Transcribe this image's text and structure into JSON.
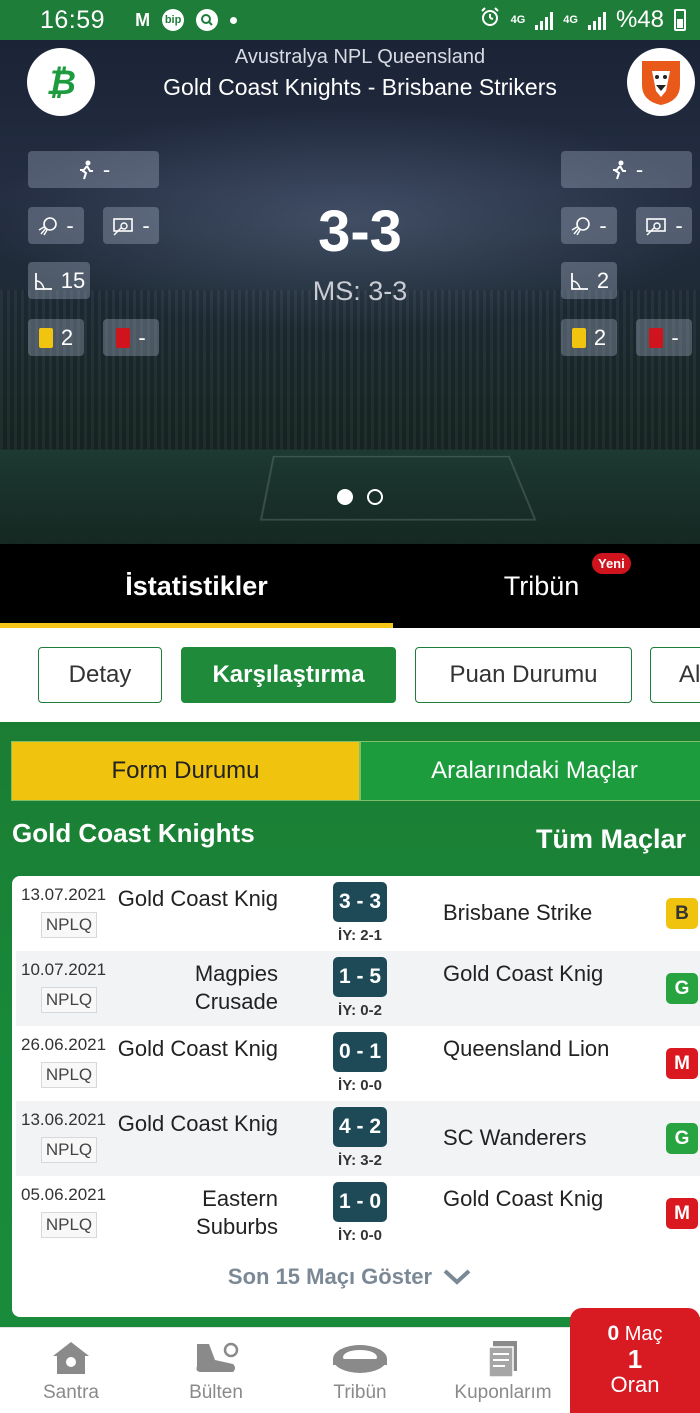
{
  "status_bar": {
    "time": "16:59",
    "m_icon": "M",
    "bip_icon": "bip",
    "network_1": "4G",
    "network_2": "4G",
    "battery": "%48"
  },
  "header": {
    "league": "Avustralya NPL Queensland",
    "match_title": "Gold Coast Knights - Brisbane Strikers",
    "score": "3-3",
    "full_time": "MS: 3-3",
    "home_stats": {
      "subs": "-",
      "shots_on": "-",
      "shots_off": "-",
      "corners": "15",
      "yellow": "2",
      "red": "-"
    },
    "away_stats": {
      "subs": "-",
      "shots_on": "-",
      "shots_off": "-",
      "corners": "2",
      "yellow": "2",
      "red": "-"
    },
    "colors": {
      "home_logo": "#1f9b3f",
      "away_logo": "#e8591a"
    }
  },
  "tabs": {
    "stats": "İstatistikler",
    "stand": "Tribün",
    "new_badge": "Yeni"
  },
  "chips": [
    "Detay",
    "Karşılaştırma",
    "Puan Durumu",
    "Al"
  ],
  "segments": {
    "form": "Form Durumu",
    "h2h": "Aralarındaki Maçlar"
  },
  "panel": {
    "team": "Gold Coast Knights",
    "all_matches": "Tüm Maçlar"
  },
  "matches": [
    {
      "date": "13.07.2021",
      "comp": "NPLQ",
      "home": "Gold Coast Knig",
      "result": "3 - 3",
      "ht": "İY: 2-1",
      "away": "Brisbane Strike",
      "form": "B"
    },
    {
      "date": "10.07.2021",
      "comp": "NPLQ",
      "home": "Magpies Crusade",
      "result": "1 - 5",
      "ht": "İY: 0-2",
      "away": "Gold Coast Knig",
      "form": "G"
    },
    {
      "date": "26.06.2021",
      "comp": "NPLQ",
      "home": "Gold Coast Knig",
      "result": "0 - 1",
      "ht": "İY: 0-0",
      "away": "Queensland Lion",
      "form": "M"
    },
    {
      "date": "13.06.2021",
      "comp": "NPLQ",
      "home": "Gold Coast Knig",
      "result": "4 - 2",
      "ht": "İY: 3-2",
      "away": "SC Wanderers",
      "form": "G"
    },
    {
      "date": "05.06.2021",
      "comp": "NPLQ",
      "home": "Eastern Suburbs",
      "result": "1 - 0",
      "ht": "İY: 0-0",
      "away": "Gold Coast Knig",
      "form": "M"
    }
  ],
  "show_more": "Son 15 Maçı Göster",
  "nav": {
    "santra": "Santra",
    "bulten": "Bülten",
    "tribun": "Tribün",
    "kuponlarim": "Kuponlarım"
  },
  "coupon": {
    "match_count": "0",
    "match_label": "Maç",
    "odds": "1",
    "odds_label": "Oran"
  }
}
